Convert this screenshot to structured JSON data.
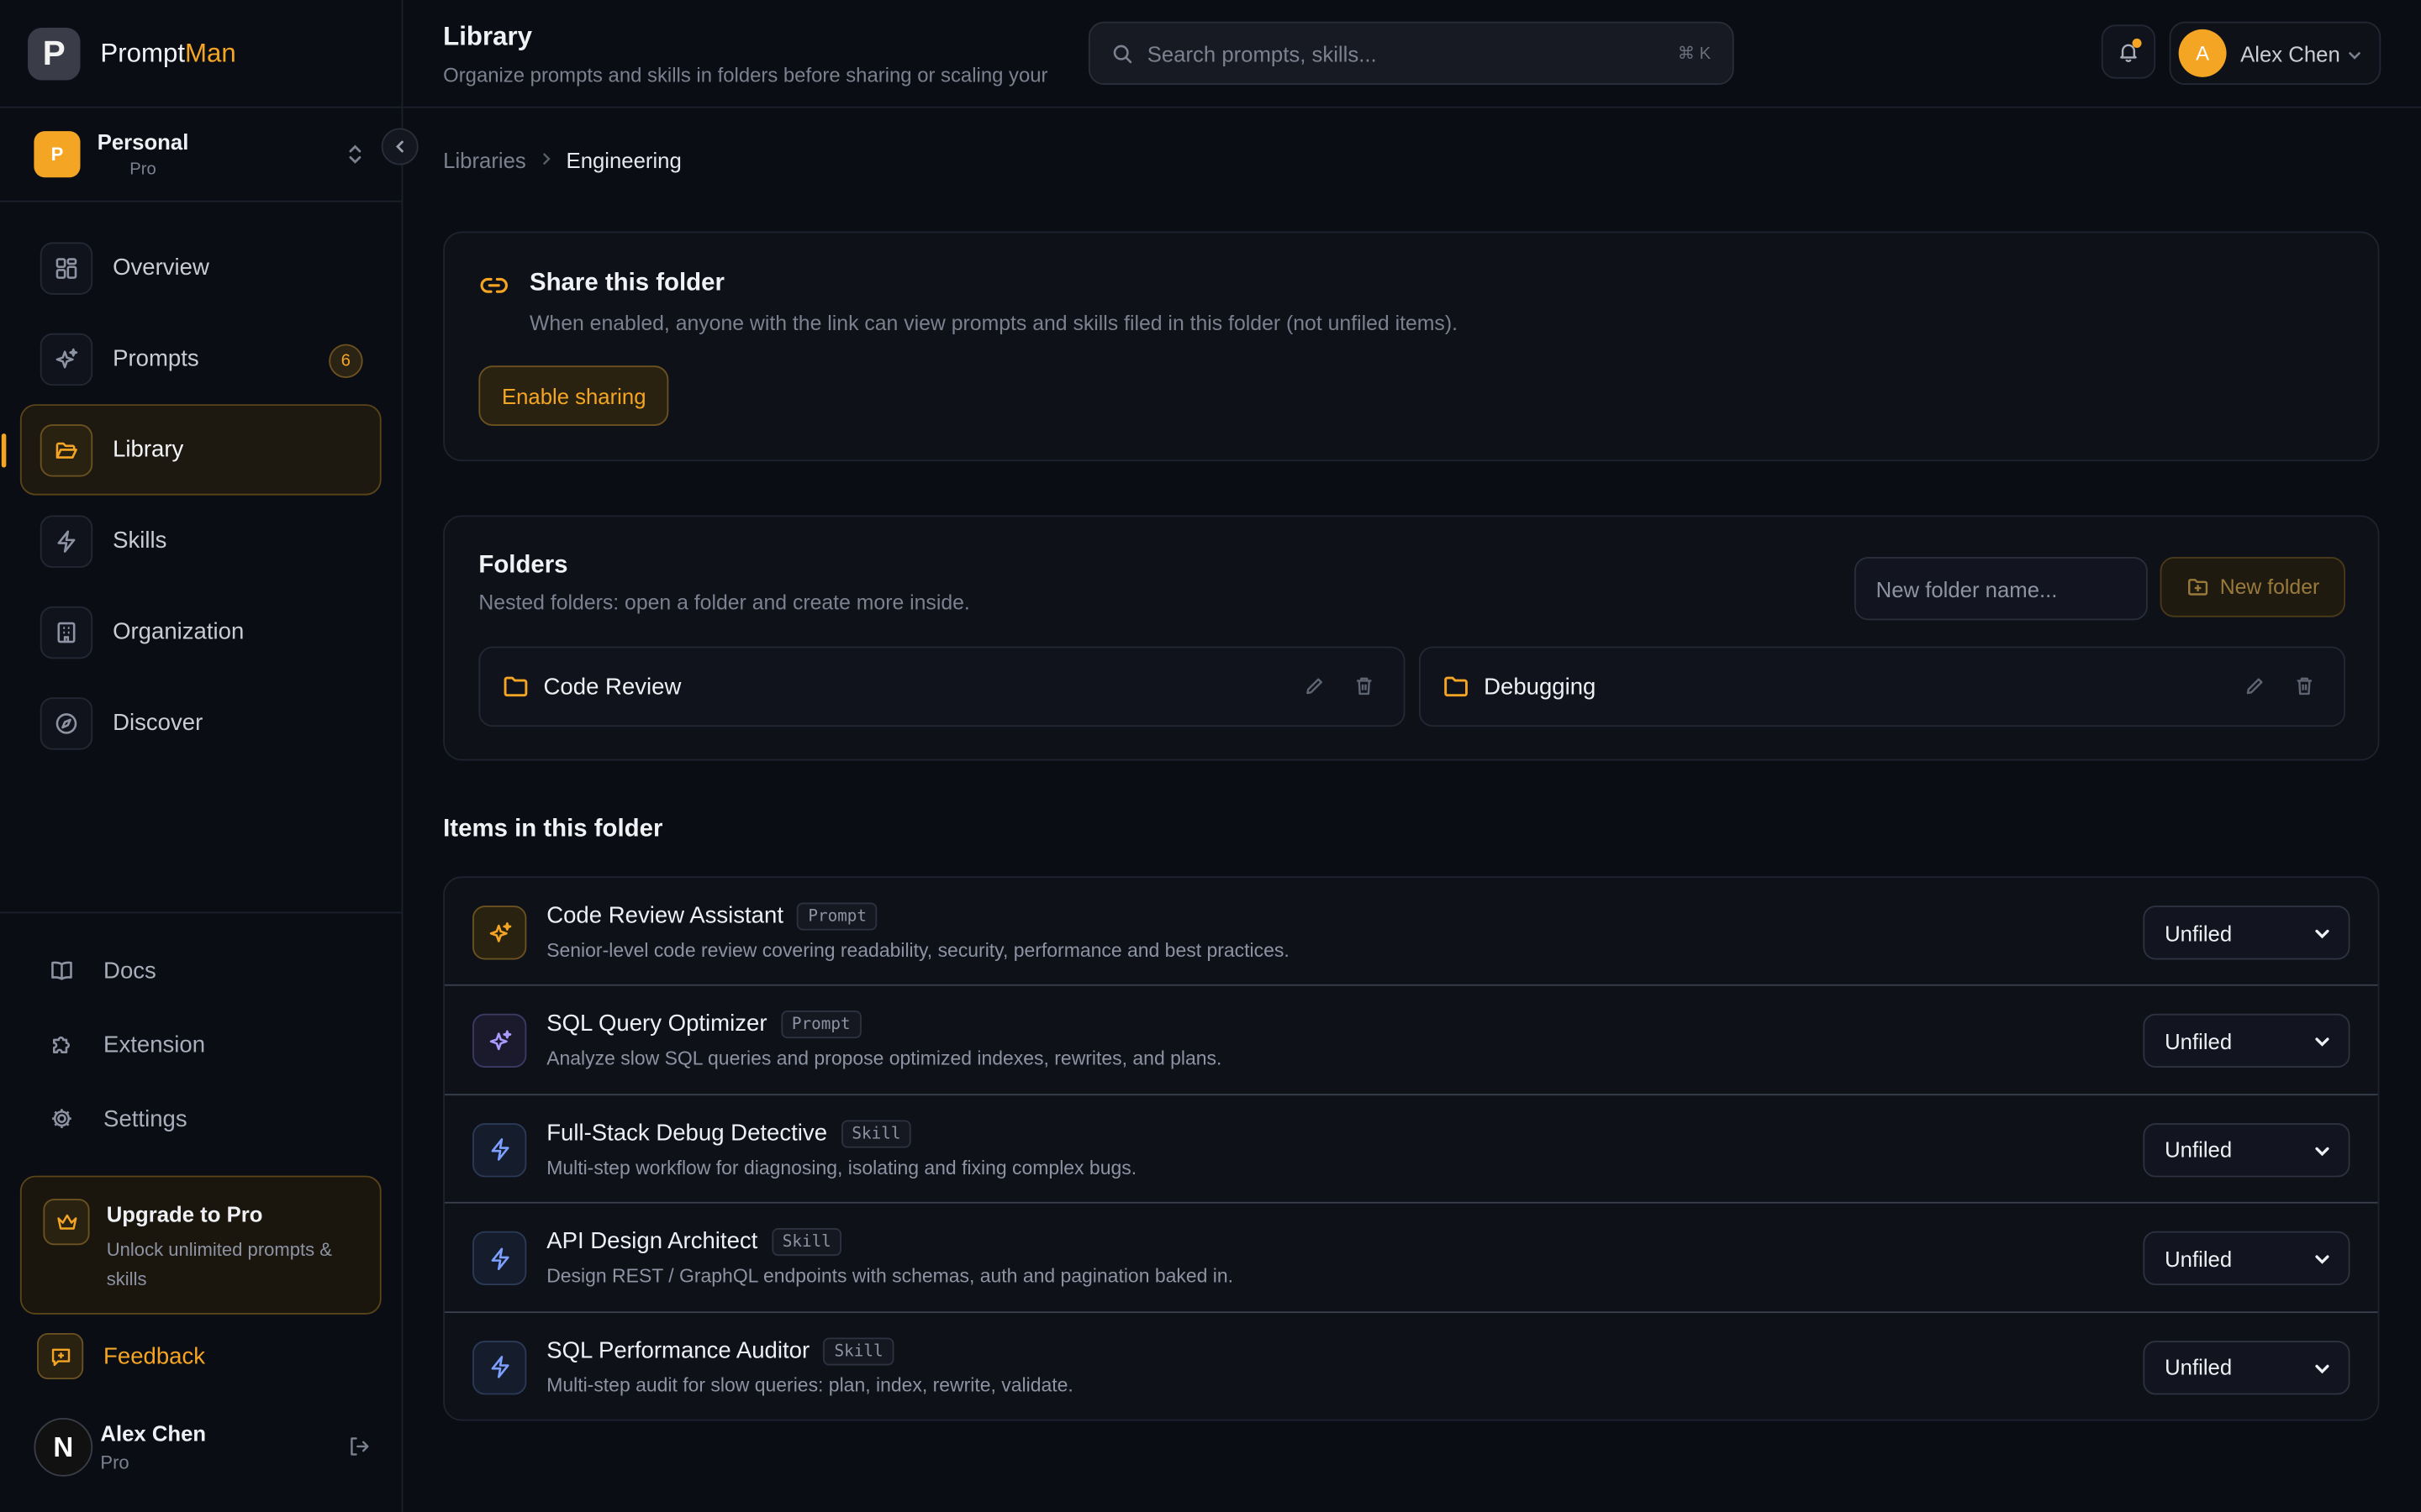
{
  "brand": {
    "logo_letter": "P",
    "name_part1": "Prompt",
    "name_part2": "Man",
    "accent_color": "#f5a524"
  },
  "workspace": {
    "avatar_letter": "P",
    "name": "Personal",
    "plan": "Pro"
  },
  "nav": {
    "items": [
      {
        "label": "Overview",
        "icon": "grid-icon"
      },
      {
        "label": "Prompts",
        "icon": "sparkles-icon",
        "badge": "6"
      },
      {
        "label": "Library",
        "icon": "folder-open-icon",
        "active": true
      },
      {
        "label": "Skills",
        "icon": "zap-icon"
      },
      {
        "label": "Organization",
        "icon": "building-icon"
      },
      {
        "label": "Discover",
        "icon": "compass-icon"
      }
    ]
  },
  "sidebar_links": [
    {
      "label": "Docs",
      "icon": "book-icon"
    },
    {
      "label": "Extension",
      "icon": "puzzle-icon"
    },
    {
      "label": "Settings",
      "icon": "gear-icon"
    }
  ],
  "upgrade": {
    "title": "Upgrade to Pro",
    "subtitle": "Unlock unlimited prompts & skills"
  },
  "feedback": {
    "label": "Feedback"
  },
  "sidebar_user": {
    "avatar_letter": "N",
    "name": "Alex Chen",
    "plan": "Pro"
  },
  "header": {
    "title": "Library",
    "subtitle": "Organize prompts and skills in folders before sharing or scaling your",
    "search_placeholder": "Search prompts, skills...",
    "search_shortcut": "⌘ K",
    "user_avatar_letter": "A",
    "user_name": "Alex Chen"
  },
  "breadcrumb": {
    "parent": "Libraries",
    "current": "Engineering"
  },
  "share": {
    "title": "Share this folder",
    "description": "When enabled, anyone with the link can view prompts and skills filed in this folder (not unfiled items).",
    "button": "Enable sharing"
  },
  "folders": {
    "title": "Folders",
    "subtitle": "Nested folders: open a folder and create more inside.",
    "input_placeholder": "New folder name...",
    "new_button": "New folder",
    "list": [
      {
        "name": "Code Review"
      },
      {
        "name": "Debugging"
      }
    ]
  },
  "items": {
    "title": "Items in this folder",
    "list": [
      {
        "name": "Code Review Assistant",
        "type": "Prompt",
        "description": "Senior-level code review covering readability, security, performance and best practices.",
        "folder": "Unfiled"
      },
      {
        "name": "SQL Query Optimizer",
        "type": "Prompt",
        "description": "Analyze slow SQL queries and propose optimized indexes, rewrites, and plans.",
        "folder": "Unfiled"
      },
      {
        "name": "Full-Stack Debug Detective",
        "type": "Skill",
        "description": "Multi-step workflow for diagnosing, isolating and fixing complex bugs.",
        "folder": "Unfiled"
      },
      {
        "name": "API Design Architect",
        "type": "Skill",
        "description": "Design REST / GraphQL endpoints with schemas, auth and pagination baked in.",
        "folder": "Unfiled"
      },
      {
        "name": "SQL Performance Auditor",
        "type": "Skill",
        "description": "Multi-step audit for slow queries: plan, index, rewrite, validate.",
        "folder": "Unfiled"
      }
    ]
  }
}
